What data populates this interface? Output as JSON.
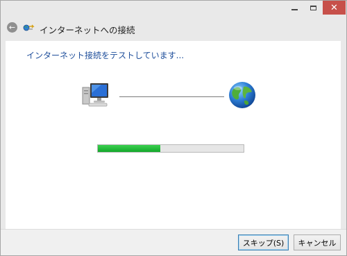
{
  "window": {
    "title": "インターネットへの接続",
    "controls": {
      "minimize_icon": "minimize-icon",
      "maximize_icon": "maximize-icon",
      "close_icon": "close-icon",
      "close_glyph": "✕"
    }
  },
  "nav": {
    "back_icon": "back-arrow-icon",
    "back_glyph": "←",
    "wizard_icon": "network-globe-icon"
  },
  "main": {
    "heading": "インターネット接続をテストしています...",
    "connection": {
      "left_icon": "computer-icon",
      "right_icon": "globe-icon"
    },
    "progress": {
      "value": 0.43,
      "color": "#22b93a"
    }
  },
  "footer": {
    "skip_label": "スキップ(S)",
    "cancel_label": "キャンセル"
  },
  "colors": {
    "heading": "#1d4d9a",
    "close_button": "#c7504a",
    "accent_border": "#3c7fb1"
  }
}
